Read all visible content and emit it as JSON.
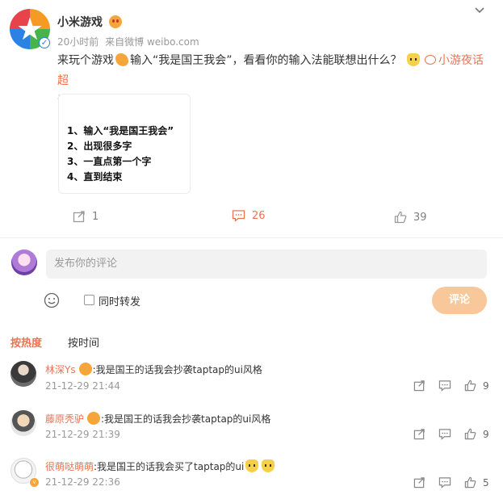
{
  "post": {
    "username": "小米游戏",
    "time": "20小时前",
    "source_prefix": "来自",
    "source": "微博 weibo.com",
    "text_parts": [
      "来玩个游戏",
      "输入“我是国王我会”，看看你的输入法能联想出什么？",
      "小游夜话超",
      "话"
    ],
    "image_lines": [
      "1、输入“我是国王我会”",
      "2、出现很多字",
      "3、一直点第一个字",
      "4、直到结束"
    ],
    "actions": {
      "forward_count": "1",
      "comment_count": "26",
      "like_count": "39"
    }
  },
  "composer": {
    "placeholder": "发布你的评论",
    "forward_label": "同时转发",
    "submit_label": "评论"
  },
  "sort": {
    "hot_label": "按热度",
    "time_label": "按时间"
  },
  "comments": [
    {
      "name": "林深Ys",
      "text": ":我是国王的话我会抄袭taptap的ui风格",
      "time": "21-12-29 21:44",
      "likes": "9"
    },
    {
      "name": "藤原秃驴",
      "text": ":我是国王的话我会抄袭taptap的ui风格",
      "time": "21-12-29 21:39",
      "likes": "9"
    },
    {
      "name": "很萌哒萌萌",
      "text": ":我是国王的话我会买了taptap的ui",
      "time": "21-12-29 22:36",
      "likes": "5"
    }
  ],
  "colors": {
    "accent": "#eb7350",
    "submit_disabled": "#f8c79a",
    "meta": "#999999"
  },
  "icons": [
    "chevron-down-icon",
    "forward-icon",
    "comment-icon",
    "like-icon",
    "emoji-icon",
    "verified-icon"
  ]
}
